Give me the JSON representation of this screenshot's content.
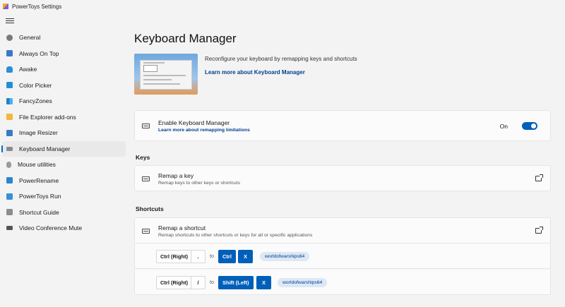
{
  "window": {
    "title": "PowerToys Settings"
  },
  "sidebar": {
    "items": [
      {
        "label": "General",
        "icon": "gear-icon",
        "color": "#7a7a7a"
      },
      {
        "label": "Always On Top",
        "icon": "always-on-top-icon",
        "color": "#3c78c8"
      },
      {
        "label": "Awake",
        "icon": "awake-icon",
        "color": "#2c8ed6"
      },
      {
        "label": "Color Picker",
        "icon": "color-picker-icon",
        "color": "#1f8fd8"
      },
      {
        "label": "FancyZones",
        "icon": "fancyzones-icon",
        "color": "#2e9be8"
      },
      {
        "label": "File Explorer add-ons",
        "icon": "file-explorer-icon",
        "color": "#f3b63d"
      },
      {
        "label": "Image Resizer",
        "icon": "image-resizer-icon",
        "color": "#3a7bc4"
      },
      {
        "label": "Keyboard Manager",
        "icon": "keyboard-icon",
        "color": "#8a8a8a"
      },
      {
        "label": "Mouse utilities",
        "icon": "mouse-icon",
        "color": "#9a9a9a"
      },
      {
        "label": "PowerRename",
        "icon": "powerrename-icon",
        "color": "#2a86d0"
      },
      {
        "label": "PowerToys Run",
        "icon": "powertoys-run-icon",
        "color": "#3a8fd6"
      },
      {
        "label": "Shortcut Guide",
        "icon": "shortcut-guide-icon",
        "color": "#8c8c8c"
      },
      {
        "label": "Video Conference Mute",
        "icon": "video-mute-icon",
        "color": "#555555"
      }
    ],
    "selected_index": 7
  },
  "main": {
    "title": "Keyboard Manager",
    "hero": {
      "description": "Reconfigure your keyboard by remapping keys and shortcuts",
      "link": "Learn more about Keyboard Manager"
    },
    "enable": {
      "title": "Enable Keyboard Manager",
      "link": "Learn more about remapping limitations",
      "state_label": "On"
    },
    "keys_section": {
      "label": "Keys",
      "remap_title": "Remap a key",
      "remap_sub": "Remap keys to other keys or shortcuts"
    },
    "shortcuts_section": {
      "label": "Shortcuts",
      "remap_title": "Remap a shortcut",
      "remap_sub": "Remap shortcuts to other shortcuts or keys for all or specific applications",
      "mappings": [
        {
          "from": [
            "Ctrl (Right)",
            "."
          ],
          "to_label": "to",
          "to": [
            "Ctrl",
            "X"
          ],
          "app": "worldofwarships64"
        },
        {
          "from": [
            "Ctrl (Right)",
            "/"
          ],
          "to_label": "to",
          "to": [
            "Shift (Left)",
            "X"
          ],
          "app": "worldofwarships64"
        }
      ]
    }
  },
  "colors": {
    "accent": "#005fb8",
    "link": "#003e92"
  }
}
